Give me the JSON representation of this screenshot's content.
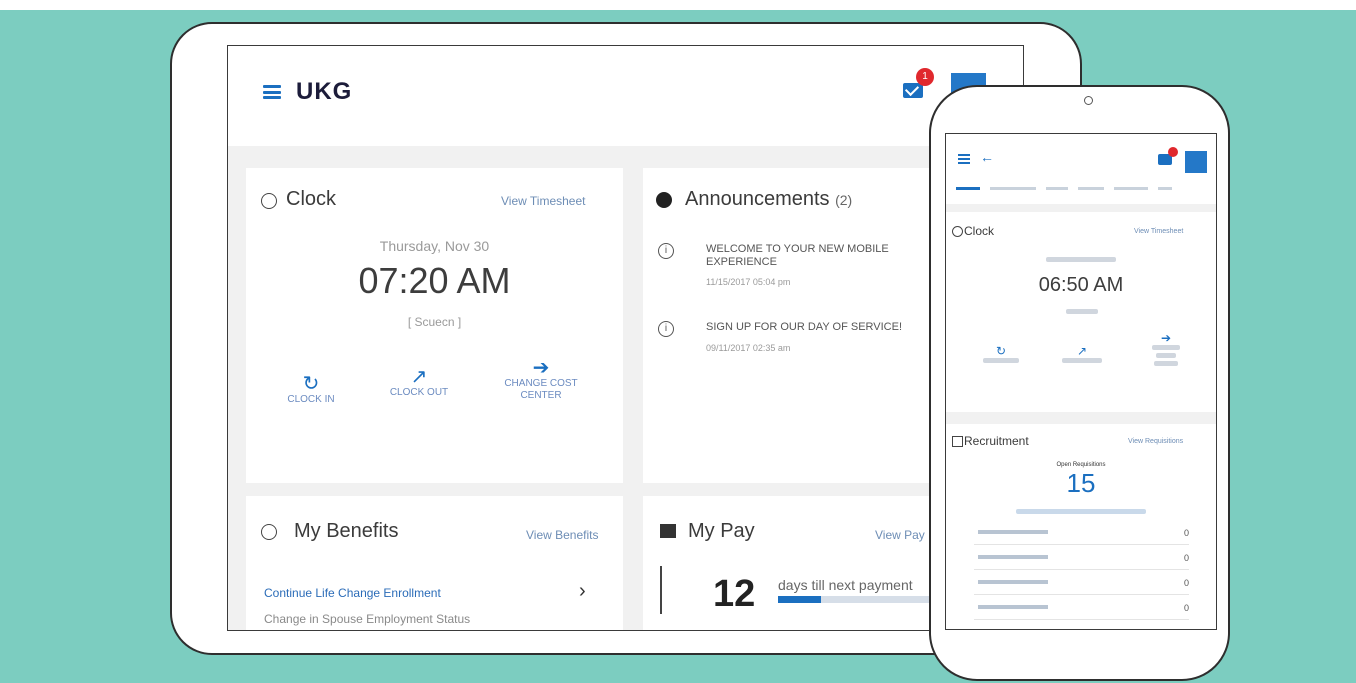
{
  "tablet": {
    "header": {
      "logo": "UKG",
      "mail_badge": "1"
    },
    "clock": {
      "title": "Clock",
      "link": "View Timesheet",
      "date": "Thursday, Nov 30",
      "time": "07:20 AM",
      "status": "[ Scuecn ]",
      "actions": {
        "in": "CLOCK IN",
        "out": "CLOCK OUT",
        "change": "CHANGE COST CENTER"
      }
    },
    "announcements": {
      "title": "Announcements",
      "count": "(2)",
      "items": [
        {
          "text": "WELCOME TO YOUR NEW MOBILE EXPERIENCE",
          "date": "11/15/2017 05:04 pm"
        },
        {
          "text": "SIGN UP FOR OUR DAY OF SERVICE!",
          "date": "09/11/2017 02:35 am"
        }
      ]
    },
    "benefits": {
      "title": "My Benefits",
      "link": "View Benefits",
      "row": "Continue Life Change Enrollment",
      "sub": "Change in Spouse Employment Status"
    },
    "pay": {
      "title": "My Pay",
      "link": "View Pay",
      "number": "12",
      "text": "days till next payment",
      "progress": 0.25
    }
  },
  "phone": {
    "clock": {
      "title": "Clock",
      "link": "View Timesheet",
      "time": "06:50 AM"
    },
    "recruitment": {
      "title": "Recruitment",
      "link": "View Requisitions",
      "label": "Open Requisitions",
      "count": "15",
      "rows": [
        {
          "value": "0"
        },
        {
          "value": "0"
        },
        {
          "value": "0"
        },
        {
          "value": "0"
        }
      ]
    }
  }
}
